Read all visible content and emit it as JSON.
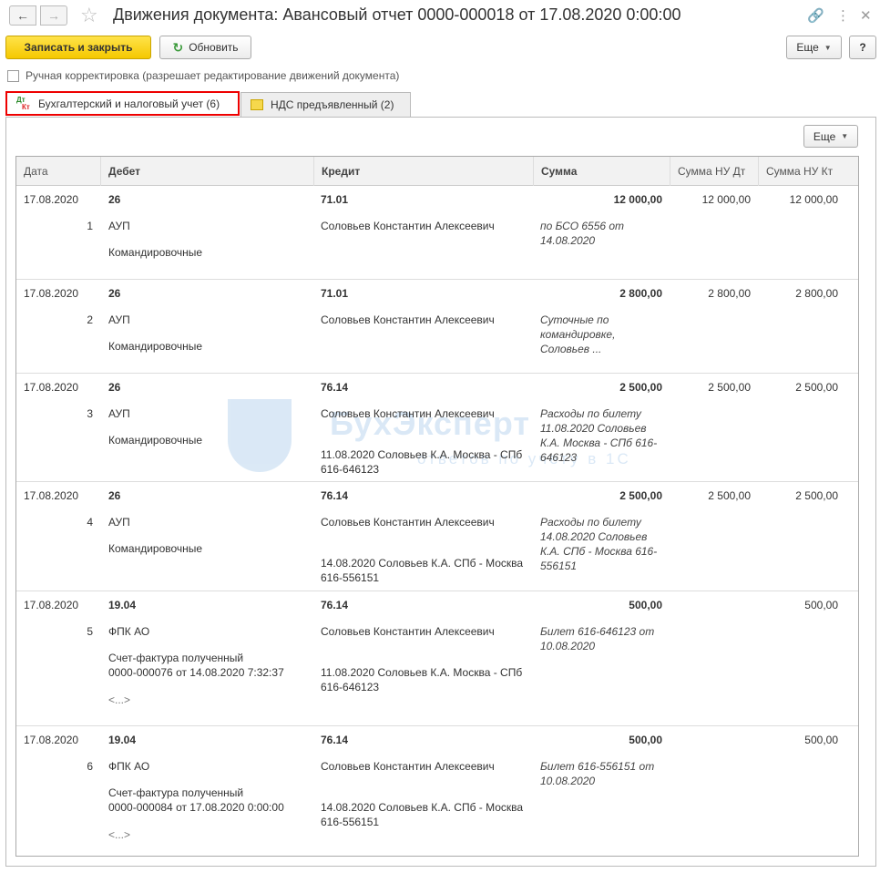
{
  "window": {
    "title": "Движения документа: Авансовый отчет 0000-000018 от 17.08.2020 0:00:00"
  },
  "toolbar": {
    "save_close": "Записать и закрыть",
    "refresh": "Обновить",
    "more": "Еще",
    "help": "?"
  },
  "manual_edit": {
    "label": "Ручная корректировка (разрешает редактирование движений документа)"
  },
  "tabs": [
    {
      "label": "Бухгалтерский и налоговый учет (6)",
      "active": true
    },
    {
      "label": "НДС предъявленный (2)",
      "active": false
    }
  ],
  "panel": {
    "more": "Еще"
  },
  "table": {
    "columns": [
      "Дата",
      "Дебет",
      "Кредит",
      "Сумма",
      "Сумма НУ Дт",
      "Сумма НУ Кт"
    ],
    "rows": [
      {
        "date": "17.08.2020",
        "num": "1",
        "debit": "26",
        "debit_sub1": "АУП",
        "debit_sub2": "Командировочные",
        "debit_sub3": "",
        "debit_sub4": "",
        "credit": "71.01",
        "credit_sub1": "Соловьев Константин Алексеевич",
        "credit_sub2": "",
        "sum": "12 000,00",
        "content": " по БСО 6556 от 14.08.2020",
        "nu_dt": "12 000,00",
        "nu_kt": "12 000,00"
      },
      {
        "date": "17.08.2020",
        "num": "2",
        "debit": "26",
        "debit_sub1": "АУП",
        "debit_sub2": "Командировочные",
        "debit_sub3": "",
        "debit_sub4": "",
        "credit": "71.01",
        "credit_sub1": "Соловьев Константин Алексеевич",
        "credit_sub2": "",
        "sum": "2 800,00",
        "content": "Суточные по командировке, Соловьев ...",
        "nu_dt": "2 800,00",
        "nu_kt": "2 800,00"
      },
      {
        "date": "17.08.2020",
        "num": "3",
        "debit": "26",
        "debit_sub1": "АУП",
        "debit_sub2": "Командировочные",
        "debit_sub3": "",
        "debit_sub4": "",
        "credit": "76.14",
        "credit_sub1": "Соловьев Константин Алексеевич",
        "credit_sub2": "11.08.2020 Соловьев К.А. Москва - СПб 616-646123",
        "sum": "2 500,00",
        "content": "Расходы по билету 11.08.2020 Соловьев К.А. Москва - СПб 616-646123",
        "nu_dt": "2 500,00",
        "nu_kt": "2 500,00"
      },
      {
        "date": "17.08.2020",
        "num": "4",
        "debit": "26",
        "debit_sub1": "АУП",
        "debit_sub2": "Командировочные",
        "debit_sub3": "",
        "debit_sub4": "",
        "credit": "76.14",
        "credit_sub1": "Соловьев Константин Алексеевич",
        "credit_sub2": "14.08.2020 Соловьев К.А. СПб - Москва 616-556151",
        "sum": "2 500,00",
        "content": "Расходы по билету 14.08.2020 Соловьев К.А. СПб - Москва 616-556151",
        "nu_dt": "2 500,00",
        "nu_kt": "2 500,00"
      },
      {
        "date": "17.08.2020",
        "num": "5",
        "debit": "19.04",
        "debit_sub1": "ФПК АО",
        "debit_sub2": "Счет-фактура полученный",
        "debit_sub3": "0000-000076 от 14.08.2020 7:32:37",
        "debit_sub4": "<...>",
        "credit": "76.14",
        "credit_sub1": "Соловьев Константин Алексеевич",
        "credit_sub2": "11.08.2020 Соловьев К.А. Москва - СПб 616-646123",
        "sum": "500,00",
        "content": "Билет 616-646123 от 10.08.2020",
        "nu_dt": "",
        "nu_kt": "500,00"
      },
      {
        "date": "17.08.2020",
        "num": "6",
        "debit": "19.04",
        "debit_sub1": "ФПК АО",
        "debit_sub2": "Счет-фактура полученный",
        "debit_sub3": "0000-000084 от 17.08.2020 0:00:00",
        "debit_sub4": "<...>",
        "credit": "76.14",
        "credit_sub1": "Соловьев Константин Алексеевич",
        "credit_sub2": "14.08.2020 Соловьев К.А. СПб - Москва 616-556151",
        "sum": "500,00",
        "content": "Билет 616-556151 от 10.08.2020",
        "nu_dt": "",
        "nu_kt": "500,00"
      }
    ]
  },
  "watermark": {
    "line1": "БухЭксперт",
    "line2": "ответов по учету в 1С"
  }
}
